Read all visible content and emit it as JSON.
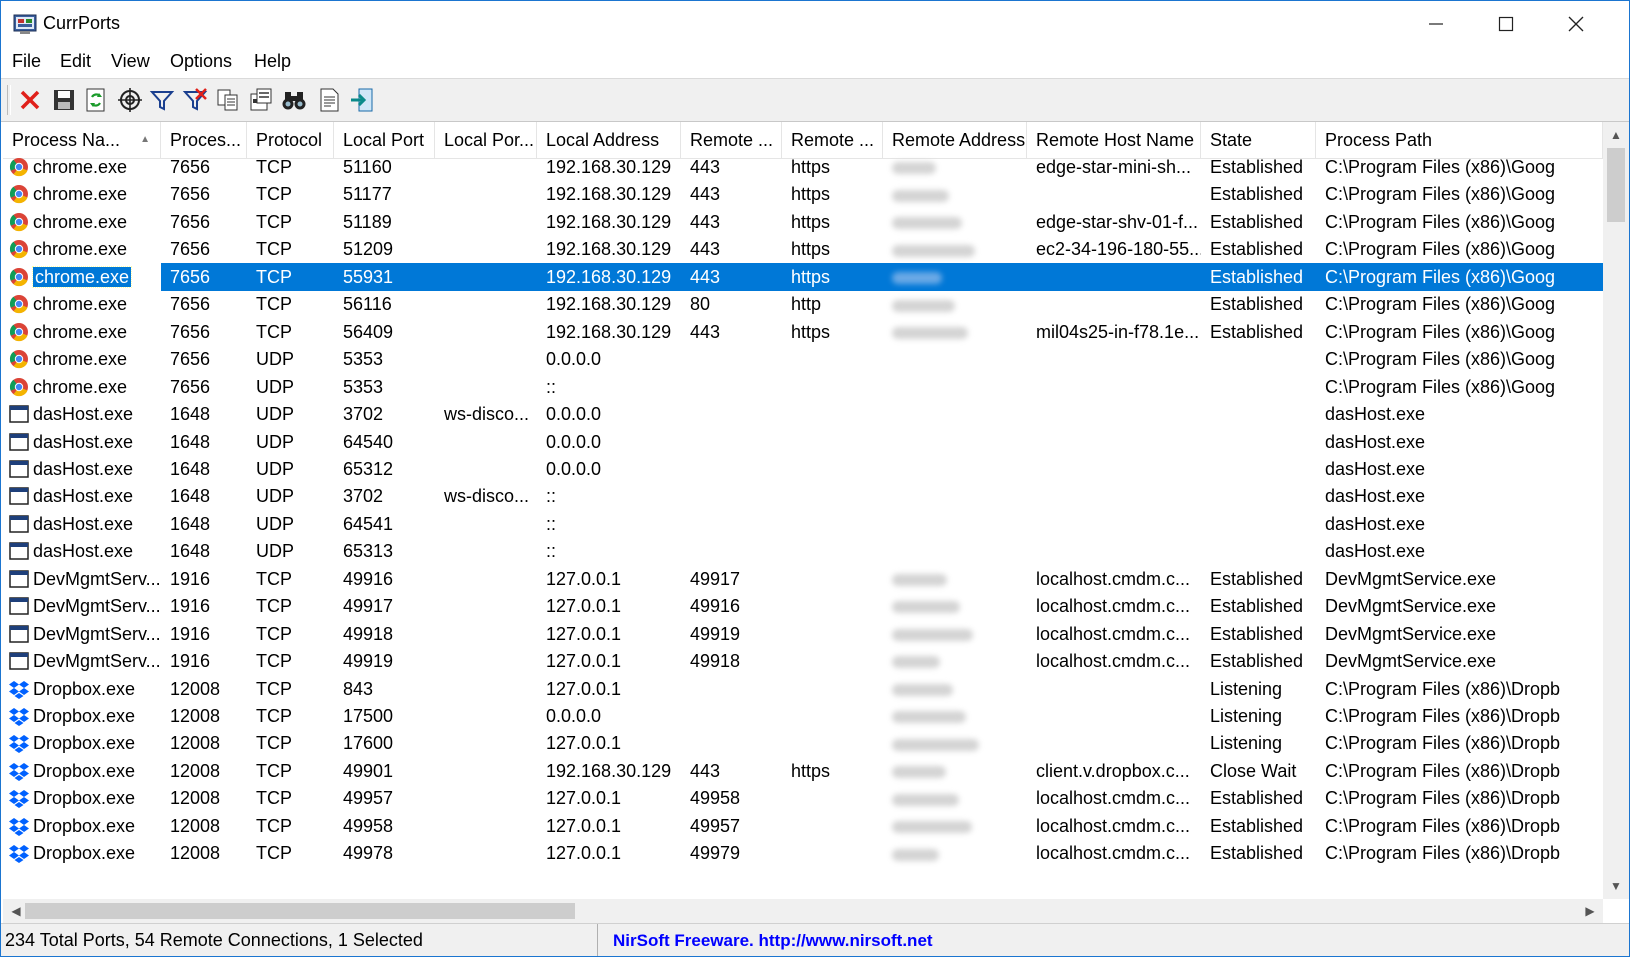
{
  "window": {
    "title": "CurrPorts"
  },
  "window_controls": {
    "minimize": "—",
    "maximize": "☐",
    "close": "✕"
  },
  "menu": [
    "File",
    "Edit",
    "View",
    "Options",
    "Help"
  ],
  "toolbar": [
    {
      "name": "close-connection-icon"
    },
    {
      "name": "save-icon"
    },
    {
      "name": "refresh-icon"
    },
    {
      "name": "target-icon"
    },
    {
      "name": "filter-icon"
    },
    {
      "name": "clear-filter-icon"
    },
    {
      "name": "copy-icon"
    },
    {
      "name": "properties-icon"
    },
    {
      "name": "find-icon"
    },
    {
      "name": "html-report-icon"
    },
    {
      "name": "exit-icon"
    }
  ],
  "columns": [
    {
      "label": "Process Na...",
      "sorted": true
    },
    {
      "label": "Proces..."
    },
    {
      "label": "Protocol"
    },
    {
      "label": "Local Port"
    },
    {
      "label": "Local Por..."
    },
    {
      "label": "Local Address"
    },
    {
      "label": "Remote ..."
    },
    {
      "label": "Remote ..."
    },
    {
      "label": "Remote Address"
    },
    {
      "label": "Remote Host Name"
    },
    {
      "label": "State"
    },
    {
      "label": "Process Path"
    }
  ],
  "rows": [
    {
      "icon": "chrome",
      "process": "chrome.exe",
      "pid": "7656",
      "protocol": "TCP",
      "local_port": "51160",
      "local_port_name": "",
      "local_address": "192.168.30.129",
      "remote_port": "443",
      "remote_port_name": "https",
      "remote_address_redacted": true,
      "remote_host": "edge-star-mini-sh...",
      "state": "Established",
      "path": "C:\\Program Files (x86)\\Goog"
    },
    {
      "icon": "chrome",
      "process": "chrome.exe",
      "pid": "7656",
      "protocol": "TCP",
      "local_port": "51177",
      "local_port_name": "",
      "local_address": "192.168.30.129",
      "remote_port": "443",
      "remote_port_name": "https",
      "remote_address_redacted": true,
      "remote_host": "",
      "state": "Established",
      "path": "C:\\Program Files (x86)\\Goog"
    },
    {
      "icon": "chrome",
      "process": "chrome.exe",
      "pid": "7656",
      "protocol": "TCP",
      "local_port": "51189",
      "local_port_name": "",
      "local_address": "192.168.30.129",
      "remote_port": "443",
      "remote_port_name": "https",
      "remote_address_redacted": true,
      "remote_host": "edge-star-shv-01-f...",
      "state": "Established",
      "path": "C:\\Program Files (x86)\\Goog"
    },
    {
      "icon": "chrome",
      "process": "chrome.exe",
      "pid": "7656",
      "protocol": "TCP",
      "local_port": "51209",
      "local_port_name": "",
      "local_address": "192.168.30.129",
      "remote_port": "443",
      "remote_port_name": "https",
      "remote_address_redacted": true,
      "remote_host": "ec2-34-196-180-55...",
      "state": "Established",
      "path": "C:\\Program Files (x86)\\Goog"
    },
    {
      "icon": "chrome",
      "process": "chrome.exe",
      "pid": "7656",
      "protocol": "TCP",
      "local_port": "55931",
      "local_port_name": "",
      "local_address": "192.168.30.129",
      "remote_port": "443",
      "remote_port_name": "https",
      "remote_address_redacted": true,
      "remote_host": "",
      "state": "Established",
      "path": "C:\\Program Files (x86)\\Goog",
      "selected": true
    },
    {
      "icon": "chrome",
      "process": "chrome.exe",
      "pid": "7656",
      "protocol": "TCP",
      "local_port": "56116",
      "local_port_name": "",
      "local_address": "192.168.30.129",
      "remote_port": "80",
      "remote_port_name": "http",
      "remote_address_redacted": true,
      "remote_host": "",
      "state": "Established",
      "path": "C:\\Program Files (x86)\\Goog"
    },
    {
      "icon": "chrome",
      "process": "chrome.exe",
      "pid": "7656",
      "protocol": "TCP",
      "local_port": "56409",
      "local_port_name": "",
      "local_address": "192.168.30.129",
      "remote_port": "443",
      "remote_port_name": "https",
      "remote_address_redacted": true,
      "remote_host": "mil04s25-in-f78.1e...",
      "state": "Established",
      "path": "C:\\Program Files (x86)\\Goog"
    },
    {
      "icon": "chrome",
      "process": "chrome.exe",
      "pid": "7656",
      "protocol": "UDP",
      "local_port": "5353",
      "local_port_name": "",
      "local_address": "0.0.0.0",
      "remote_port": "",
      "remote_port_name": "",
      "remote_address_redacted": false,
      "remote_host": "",
      "state": "",
      "path": "C:\\Program Files (x86)\\Goog"
    },
    {
      "icon": "chrome",
      "process": "chrome.exe",
      "pid": "7656",
      "protocol": "UDP",
      "local_port": "5353",
      "local_port_name": "",
      "local_address": "::",
      "remote_port": "",
      "remote_port_name": "",
      "remote_address_redacted": false,
      "remote_host": "",
      "state": "",
      "path": "C:\\Program Files (x86)\\Goog"
    },
    {
      "icon": "window",
      "process": "dasHost.exe",
      "pid": "1648",
      "protocol": "UDP",
      "local_port": "3702",
      "local_port_name": "ws-disco...",
      "local_address": "0.0.0.0",
      "remote_port": "",
      "remote_port_name": "",
      "remote_address_redacted": false,
      "remote_host": "",
      "state": "",
      "path": "dasHost.exe"
    },
    {
      "icon": "window",
      "process": "dasHost.exe",
      "pid": "1648",
      "protocol": "UDP",
      "local_port": "64540",
      "local_port_name": "",
      "local_address": "0.0.0.0",
      "remote_port": "",
      "remote_port_name": "",
      "remote_address_redacted": false,
      "remote_host": "",
      "state": "",
      "path": "dasHost.exe"
    },
    {
      "icon": "window",
      "process": "dasHost.exe",
      "pid": "1648",
      "protocol": "UDP",
      "local_port": "65312",
      "local_port_name": "",
      "local_address": "0.0.0.0",
      "remote_port": "",
      "remote_port_name": "",
      "remote_address_redacted": false,
      "remote_host": "",
      "state": "",
      "path": "dasHost.exe"
    },
    {
      "icon": "window",
      "process": "dasHost.exe",
      "pid": "1648",
      "protocol": "UDP",
      "local_port": "3702",
      "local_port_name": "ws-disco...",
      "local_address": "::",
      "remote_port": "",
      "remote_port_name": "",
      "remote_address_redacted": false,
      "remote_host": "",
      "state": "",
      "path": "dasHost.exe"
    },
    {
      "icon": "window",
      "process": "dasHost.exe",
      "pid": "1648",
      "protocol": "UDP",
      "local_port": "64541",
      "local_port_name": "",
      "local_address": "::",
      "remote_port": "",
      "remote_port_name": "",
      "remote_address_redacted": false,
      "remote_host": "",
      "state": "",
      "path": "dasHost.exe"
    },
    {
      "icon": "window",
      "process": "dasHost.exe",
      "pid": "1648",
      "protocol": "UDP",
      "local_port": "65313",
      "local_port_name": "",
      "local_address": "::",
      "remote_port": "",
      "remote_port_name": "",
      "remote_address_redacted": false,
      "remote_host": "",
      "state": "",
      "path": "dasHost.exe"
    },
    {
      "icon": "window",
      "process": "DevMgmtServ...",
      "pid": "1916",
      "protocol": "TCP",
      "local_port": "49916",
      "local_port_name": "",
      "local_address": "127.0.0.1",
      "remote_port": "49917",
      "remote_port_name": "",
      "remote_address_redacted": true,
      "remote_host": "localhost.cmdm.c...",
      "state": "Established",
      "path": "DevMgmtService.exe"
    },
    {
      "icon": "window",
      "process": "DevMgmtServ...",
      "pid": "1916",
      "protocol": "TCP",
      "local_port": "49917",
      "local_port_name": "",
      "local_address": "127.0.0.1",
      "remote_port": "49916",
      "remote_port_name": "",
      "remote_address_redacted": true,
      "remote_host": "localhost.cmdm.c...",
      "state": "Established",
      "path": "DevMgmtService.exe"
    },
    {
      "icon": "window",
      "process": "DevMgmtServ...",
      "pid": "1916",
      "protocol": "TCP",
      "local_port": "49918",
      "local_port_name": "",
      "local_address": "127.0.0.1",
      "remote_port": "49919",
      "remote_port_name": "",
      "remote_address_redacted": true,
      "remote_host": "localhost.cmdm.c...",
      "state": "Established",
      "path": "DevMgmtService.exe"
    },
    {
      "icon": "window",
      "process": "DevMgmtServ...",
      "pid": "1916",
      "protocol": "TCP",
      "local_port": "49919",
      "local_port_name": "",
      "local_address": "127.0.0.1",
      "remote_port": "49918",
      "remote_port_name": "",
      "remote_address_redacted": true,
      "remote_host": "localhost.cmdm.c...",
      "state": "Established",
      "path": "DevMgmtService.exe"
    },
    {
      "icon": "dropbox",
      "process": "Dropbox.exe",
      "pid": "12008",
      "protocol": "TCP",
      "local_port": "843",
      "local_port_name": "",
      "local_address": "127.0.0.1",
      "remote_port": "",
      "remote_port_name": "",
      "remote_address_redacted": true,
      "remote_host": "",
      "state": "Listening",
      "path": "C:\\Program Files (x86)\\Dropb"
    },
    {
      "icon": "dropbox",
      "process": "Dropbox.exe",
      "pid": "12008",
      "protocol": "TCP",
      "local_port": "17500",
      "local_port_name": "",
      "local_address": "0.0.0.0",
      "remote_port": "",
      "remote_port_name": "",
      "remote_address_redacted": true,
      "remote_host": "",
      "state": "Listening",
      "path": "C:\\Program Files (x86)\\Dropb"
    },
    {
      "icon": "dropbox",
      "process": "Dropbox.exe",
      "pid": "12008",
      "protocol": "TCP",
      "local_port": "17600",
      "local_port_name": "",
      "local_address": "127.0.0.1",
      "remote_port": "",
      "remote_port_name": "",
      "remote_address_redacted": true,
      "remote_host": "",
      "state": "Listening",
      "path": "C:\\Program Files (x86)\\Dropb"
    },
    {
      "icon": "dropbox",
      "process": "Dropbox.exe",
      "pid": "12008",
      "protocol": "TCP",
      "local_port": "49901",
      "local_port_name": "",
      "local_address": "192.168.30.129",
      "remote_port": "443",
      "remote_port_name": "https",
      "remote_address_redacted": true,
      "remote_host": "client.v.dropbox.c...",
      "state": "Close Wait",
      "path": "C:\\Program Files (x86)\\Dropb"
    },
    {
      "icon": "dropbox",
      "process": "Dropbox.exe",
      "pid": "12008",
      "protocol": "TCP",
      "local_port": "49957",
      "local_port_name": "",
      "local_address": "127.0.0.1",
      "remote_port": "49958",
      "remote_port_name": "",
      "remote_address_redacted": true,
      "remote_host": "localhost.cmdm.c...",
      "state": "Established",
      "path": "C:\\Program Files (x86)\\Dropb"
    },
    {
      "icon": "dropbox",
      "process": "Dropbox.exe",
      "pid": "12008",
      "protocol": "TCP",
      "local_port": "49958",
      "local_port_name": "",
      "local_address": "127.0.0.1",
      "remote_port": "49957",
      "remote_port_name": "",
      "remote_address_redacted": true,
      "remote_host": "localhost.cmdm.c...",
      "state": "Established",
      "path": "C:\\Program Files (x86)\\Dropb"
    },
    {
      "icon": "dropbox",
      "process": "Dropbox.exe",
      "pid": "12008",
      "protocol": "TCP",
      "local_port": "49978",
      "local_port_name": "",
      "local_address": "127.0.0.1",
      "remote_port": "49979",
      "remote_port_name": "",
      "remote_address_redacted": true,
      "remote_host": "localhost.cmdm.c...",
      "state": "Established",
      "path": "C:\\Program Files (x86)\\Dropb"
    }
  ],
  "status": {
    "summary": "234 Total Ports, 54 Remote Connections, 1 Selected",
    "credit": "NirSoft Freeware.  http://www.nirsoft.net"
  },
  "colors": {
    "selection": "#0078d7",
    "credit_link": "#0000ff",
    "window_border": "#1b75d0"
  }
}
